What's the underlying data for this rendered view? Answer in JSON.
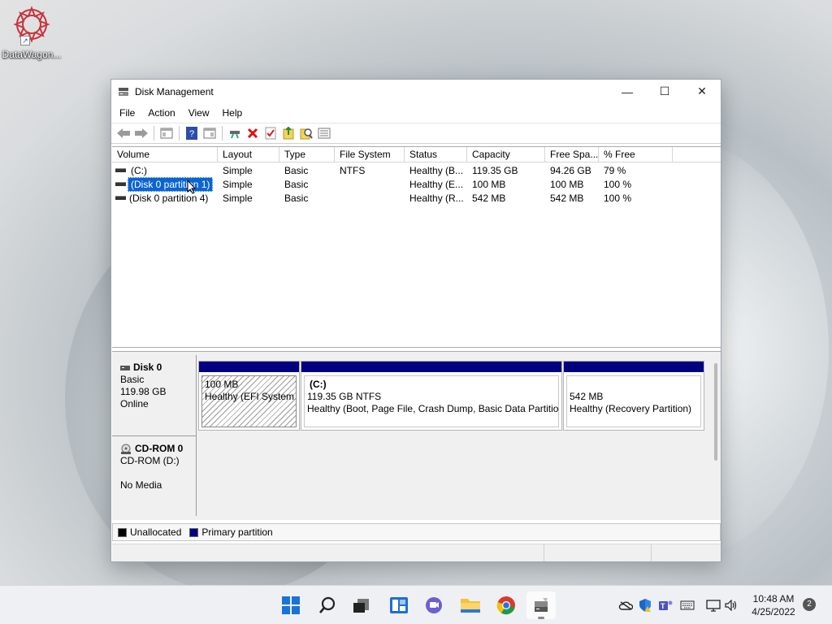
{
  "desktop": {
    "icons": [
      {
        "label": "DataWagon...",
        "icon": "datawagon-icon"
      }
    ]
  },
  "window": {
    "title": "Disk Management",
    "controls": {
      "minimize": "—",
      "maximize": "☐",
      "close": "✕"
    },
    "menu": [
      "File",
      "Action",
      "View",
      "Help"
    ],
    "toolbar_icons": [
      "back-icon",
      "forward-icon",
      "console-tree-icon",
      "help-icon",
      "properties-icon",
      "connect-icon",
      "delete-icon",
      "check-icon",
      "export-icon",
      "find-icon",
      "list-icon"
    ]
  },
  "volume_list": {
    "columns": [
      "Volume",
      "Layout",
      "Type",
      "File System",
      "Status",
      "Capacity",
      "Free Spa...",
      "% Free"
    ],
    "rows": [
      {
        "volume": "(C:)",
        "layout": "Simple",
        "type": "Basic",
        "fs": "NTFS",
        "status": "Healthy (B...",
        "capacity": "119.35 GB",
        "free": "94.26 GB",
        "pct": "79 %"
      },
      {
        "volume": "(Disk 0 partition 1)",
        "layout": "Simple",
        "type": "Basic",
        "fs": "",
        "status": "Healthy (E...",
        "capacity": "100 MB",
        "free": "100 MB",
        "pct": "100 %"
      },
      {
        "volume": "(Disk 0 partition 4)",
        "layout": "Simple",
        "type": "Basic",
        "fs": "",
        "status": "Healthy (R...",
        "capacity": "542 MB",
        "free": "542 MB",
        "pct": "100 %"
      }
    ]
  },
  "disks": [
    {
      "name": "Disk 0",
      "type": "Basic",
      "size": "119.98 GB",
      "state": "Online",
      "partitions": [
        {
          "title": "",
          "size": "100 MB",
          "status": "Healthy (EFI System Partition)"
        },
        {
          "title": "(C:)",
          "size": "119.35 GB NTFS",
          "status": "Healthy (Boot, Page File, Crash Dump, Basic Data Partition)"
        },
        {
          "title": "",
          "size": "542 MB",
          "status": "Healthy (Recovery Partition)"
        }
      ]
    },
    {
      "name": "CD-ROM 0",
      "type": "CD-ROM (D:)",
      "size": "",
      "state": "No Media",
      "partitions": []
    }
  ],
  "legend": [
    {
      "label": "Unallocated",
      "color": "#000000"
    },
    {
      "label": "Primary partition",
      "color": "#000080"
    }
  ],
  "taskbar": {
    "apps": [
      "windows-start-icon",
      "search-icon",
      "task-view-icon",
      "widgets-icon",
      "chat-icon",
      "file-explorer-icon",
      "chrome-icon",
      "disk-management-icon"
    ],
    "tray_icons": [
      "onedrive-icon",
      "security-icon",
      "teams-icon",
      "keyboard-icon",
      "network-icon",
      "volume-icon"
    ],
    "clock_time": "10:48 AM",
    "clock_date": "4/25/2022",
    "notification_count": "2"
  }
}
